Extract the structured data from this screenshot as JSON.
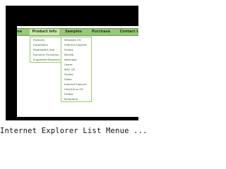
{
  "menubar": {
    "items": [
      {
        "label": "Home"
      },
      {
        "label": "Product Info"
      },
      {
        "label": "Samples"
      },
      {
        "label": "Purchase"
      },
      {
        "label": "Contact Us"
      }
    ]
  },
  "product_submenu": {
    "items": [
      {
        "label": "Features"
      },
      {
        "label": "Installation"
      },
      {
        "label": "Parameters Info"
      },
      {
        "label": "Dynamic Functions"
      },
      {
        "label": "Supported Browsers"
      }
    ]
  },
  "samples_submenu": {
    "items": [
      {
        "label": "Windows OS"
      },
      {
        "label": "Internet Explorer"
      },
      {
        "label": "Firefox"
      },
      {
        "label": "Mozilla"
      },
      {
        "label": "Netscape"
      },
      {
        "label": "Opera"
      },
      {
        "label": "MAC OS"
      },
      {
        "label": "Firefox"
      },
      {
        "label": "Safari"
      },
      {
        "label": "Internet Explorer"
      },
      {
        "label": "Unix/Linux OS"
      },
      {
        "label": "Firefox"
      },
      {
        "label": "Konqueror"
      }
    ]
  },
  "caption": "Internet Explorer List Menue ..."
}
